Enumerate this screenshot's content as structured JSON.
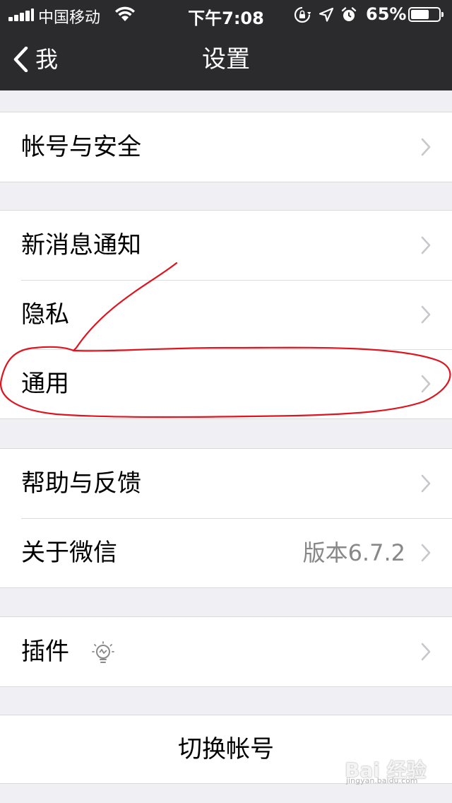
{
  "status_bar": {
    "carrier": "中国移动",
    "time": "下午7:08",
    "battery_percent": "65%",
    "battery_level": 0.65,
    "icons": [
      "signal-icon",
      "wifi-icon",
      "orientation-lock-icon",
      "location-icon",
      "alarm-icon",
      "battery-icon"
    ]
  },
  "nav": {
    "back_label": "我",
    "title": "设置"
  },
  "groups": [
    {
      "rows": [
        {
          "label": "帐号与安全"
        }
      ]
    },
    {
      "rows": [
        {
          "label": "新消息通知"
        },
        {
          "label": "隐私"
        },
        {
          "label": "通用"
        }
      ]
    },
    {
      "rows": [
        {
          "label": "帮助与反馈"
        },
        {
          "label": "关于微信",
          "value": "版本6.7.2"
        }
      ]
    },
    {
      "rows": [
        {
          "label": "插件",
          "icon": "lightbulb-icon"
        }
      ]
    }
  ],
  "switch_account": {
    "label": "切换帐号"
  },
  "watermark": {
    "text": "Bai 经验",
    "sub": "jingyan.baidu.com"
  },
  "colors": {
    "header_bg": "#2b2b2e",
    "page_bg": "#efeff4",
    "annotation": "#e0141e"
  }
}
